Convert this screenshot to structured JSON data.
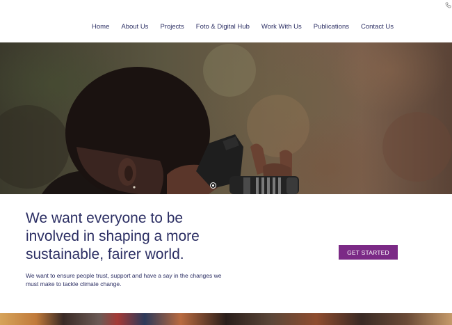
{
  "nav": {
    "items": [
      {
        "label": "Home"
      },
      {
        "label": "About Us"
      },
      {
        "label": "Projects"
      },
      {
        "label": "Foto & Digital Hub"
      },
      {
        "label": "Work With Us"
      },
      {
        "label": "Publications"
      },
      {
        "label": "Contact Us"
      }
    ],
    "utility_icon": "phone-icon"
  },
  "hero": {
    "image": "person-with-camera-photo",
    "slider_dots": 1
  },
  "main": {
    "headline": "We want everyone to be involved in shaping a more sustainable, fairer world.",
    "subtext": "We want to ensure people trust, support and have a say in the changes we must make to tackle climate change.",
    "cta_label": "GET STARTED"
  },
  "colors": {
    "text": "#2b2e63",
    "accent": "#7b2a86",
    "background": "#ffffff"
  }
}
